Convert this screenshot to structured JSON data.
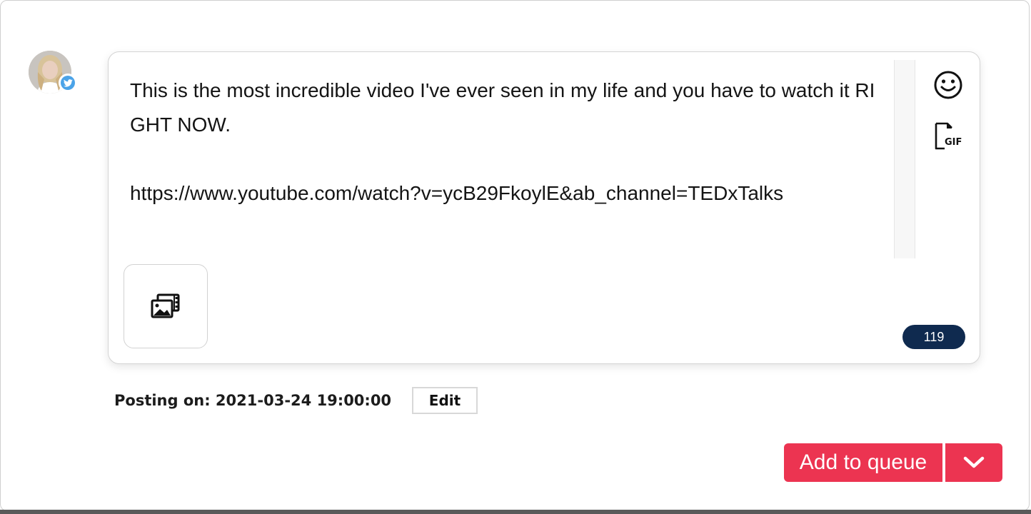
{
  "account": {
    "avatar_icon": "user-avatar-photo",
    "network_icon": "twitter-bird-icon",
    "network_color": "#4ba3e8"
  },
  "composer": {
    "text": "This is the most incredible video I've ever seen in my life and you have to watch it RIGHT NOW.\n\nhttps://www.youtube.com/watch?v=ycB29FkoylE&ab_channel=TEDxTalks",
    "emoji_icon": "smiley-face-icon",
    "gif_icon": "gif-file-icon",
    "media_icon": "image-gallery-icon",
    "char_count": "119",
    "char_count_color": "#0f2a4f"
  },
  "schedule": {
    "label": "Posting on: 2021-03-24 19:00:00",
    "edit_label": "Edit"
  },
  "actions": {
    "add_to_queue_label": "Add to queue",
    "dropdown_icon": "chevron-down-icon",
    "accent_color": "#ec3451"
  }
}
